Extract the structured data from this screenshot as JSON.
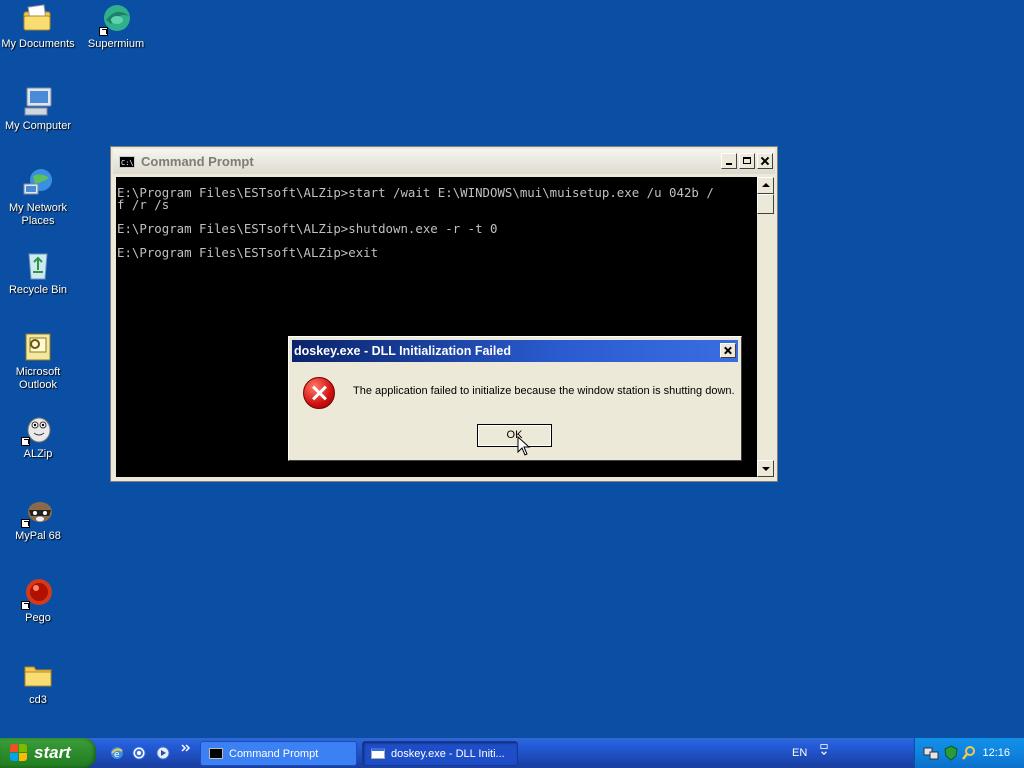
{
  "desktop": {
    "icons": [
      {
        "label": "My Documents",
        "icon": "folder-documents-icon"
      },
      {
        "label": "Supermium",
        "icon": "browser-icon"
      },
      {
        "label": "My Computer",
        "icon": "computer-icon"
      },
      {
        "label": "My Network Places",
        "icon": "network-icon"
      },
      {
        "label": "Recycle Bin",
        "icon": "recycle-bin-icon"
      },
      {
        "label": "Microsoft Outlook",
        "icon": "outlook-icon"
      },
      {
        "label": "ALZip",
        "icon": "alzip-icon"
      },
      {
        "label": "MyPal 68",
        "icon": "mypal-icon"
      },
      {
        "label": "Pego",
        "icon": "pego-icon"
      },
      {
        "label": "cd3",
        "icon": "folder-icon"
      }
    ]
  },
  "cmd_window": {
    "title": "Command Prompt",
    "icon_text": "C:\\",
    "lines": [
      "E:\\Program Files\\ESTsoft\\ALZip>start /wait E:\\WINDOWS\\mui\\muisetup.exe /u 042b /",
      "f /r /s",
      "",
      "E:\\Program Files\\ESTsoft\\ALZip>shutdown.exe -r -t 0",
      "",
      "E:\\Program Files\\ESTsoft\\ALZip>exit"
    ]
  },
  "error_dialog": {
    "title": "doskey.exe - DLL Initialization Failed",
    "message": "The application failed to initialize because the window station is shutting down.",
    "ok_label": "OK"
  },
  "taskbar": {
    "start_label": "start",
    "tasks": [
      {
        "label": "Command Prompt",
        "active": false
      },
      {
        "label": "doskey.exe - DLL Initi...",
        "active": true
      }
    ],
    "language": "EN",
    "clock": "12:16"
  },
  "colors": {
    "desktop_bg": "#0a4fa3",
    "taskbar": "#245edb",
    "start_green": "#2d8c2d",
    "dialog_title": "#0a246a"
  }
}
